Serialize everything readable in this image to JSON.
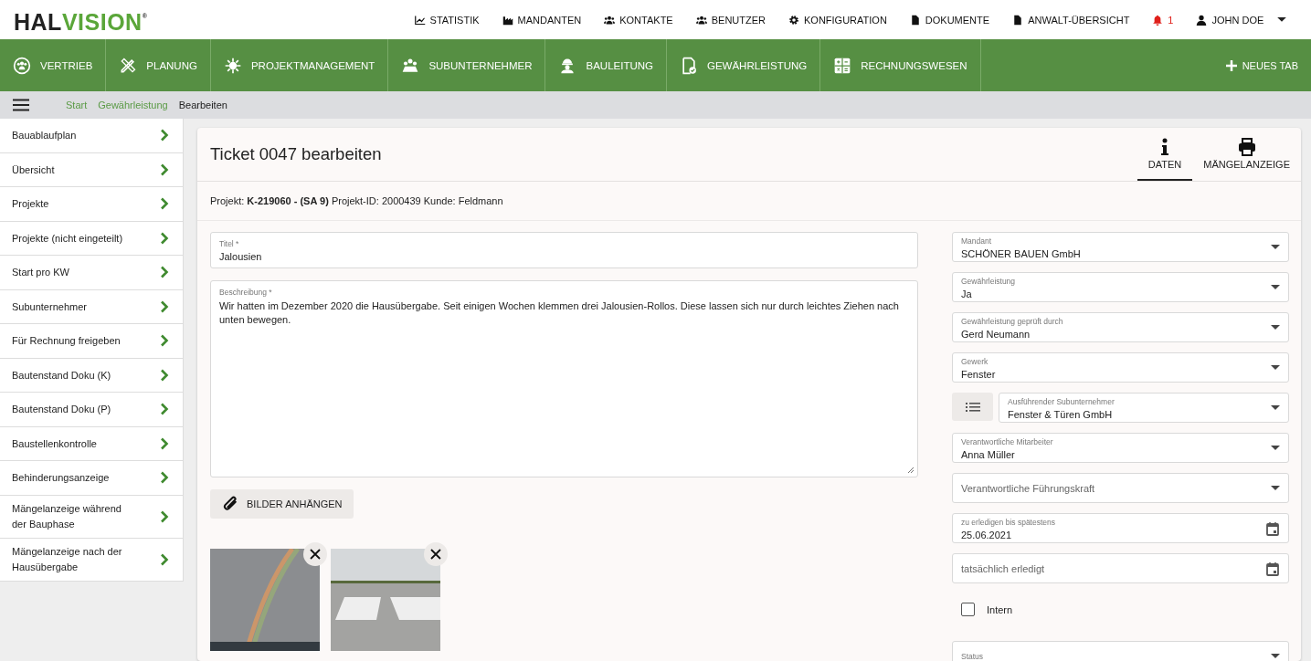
{
  "logo": {
    "dark": "HAL",
    "green": "VISION",
    "mark": "®"
  },
  "top_menu": [
    {
      "label": "STATISTIK"
    },
    {
      "label": "MANDANTEN"
    },
    {
      "label": "KONTAKTE"
    },
    {
      "label": "BENUTZER"
    },
    {
      "label": "KONFIGURATION"
    },
    {
      "label": "DOKUMENTE"
    },
    {
      "label": "ANWALT-ÜBERSICHT"
    }
  ],
  "notifications": {
    "count": "1"
  },
  "user": {
    "name": "JOHN DOE"
  },
  "modules": [
    {
      "label": "VERTRIEB"
    },
    {
      "label": "PLANUNG"
    },
    {
      "label": "PROJEKTMANAGEMENT"
    },
    {
      "label": "SUBUNTERNEHMER"
    },
    {
      "label": "BAULEITUNG"
    },
    {
      "label": "GEWÄHRLEISTUNG"
    },
    {
      "label": "RECHNUNGSWESEN"
    }
  ],
  "new_tab": "NEUES TAB",
  "breadcrumb": [
    {
      "label": "Start",
      "selected": false
    },
    {
      "label": "Gewährleistung",
      "selected": false
    },
    {
      "label": "Bearbeiten",
      "selected": true
    }
  ],
  "sidebar": {
    "items": [
      "Bauablaufplan",
      "Übersicht",
      "Projekte",
      "Projekte (nicht eingeteilt)",
      "Start pro KW",
      "Subunternehmer",
      "Für Rechnung freigeben",
      "Bautenstand Doku (K)",
      "Bautenstand Doku (P)",
      "Baustellenkontrolle",
      "Behinderungsanzeige",
      "Mängelanzeige während der Bauphase",
      "Mängelanzeige nach der Hausübergabe"
    ]
  },
  "card": {
    "title": "Ticket 0047 bearbeiten",
    "tabs": [
      {
        "label": "DATEN",
        "selected": true
      },
      {
        "label": "MÄNGELANZEIGE",
        "selected": false
      }
    ],
    "project_line": "Projekt: **K-219060 - (SA 9)** Projekt-ID: 2000439  Kunde: Feldmann",
    "title_field": {
      "label": "Titel *",
      "value": "Jalousien"
    },
    "description_field": {
      "label": "Beschreibung *",
      "value": "Wir hatten im Dezember 2020 die Hausübergabe. Seit einigen Wochen klemmen drei Jalousien-Rollos. Diese lassen sich nur durch leichtes Ziehen nach unten bewegen."
    },
    "attach_button": "BILDER ANHÄNGEN",
    "images": [
      {
        "kind": "rainbow"
      },
      {
        "kind": "runway"
      }
    ],
    "fields": [
      {
        "kind": "select",
        "label": "Mandant",
        "value": "SCHÖNER BAUEN GmbH"
      },
      {
        "kind": "select",
        "label": "Gewährleistung",
        "value": "Ja"
      },
      {
        "kind": "select",
        "label": "Gewährleistung geprüft durch",
        "value": "Gerd Neumann"
      },
      {
        "kind": "select",
        "label": "Gewerk",
        "value": "Fenster"
      },
      {
        "kind": "select_list",
        "label": "Ausführender Subunternehmer",
        "value": "Fenster & Türen GmbH"
      },
      {
        "kind": "select",
        "label": "Verantwortliche Mitarbeiter",
        "value": "Anna Müller"
      },
      {
        "kind": "select",
        "placeholder": "Verantwortliche Führungskraft"
      },
      {
        "kind": "date",
        "label": "zu erledigen bis spätestens",
        "value": "25.06.2021"
      },
      {
        "kind": "date",
        "placeholder": "tatsächlich erledigt"
      },
      {
        "kind": "checkbox",
        "label": "Intern",
        "checked": false
      },
      {
        "kind": "select",
        "label": "Status"
      }
    ]
  }
}
